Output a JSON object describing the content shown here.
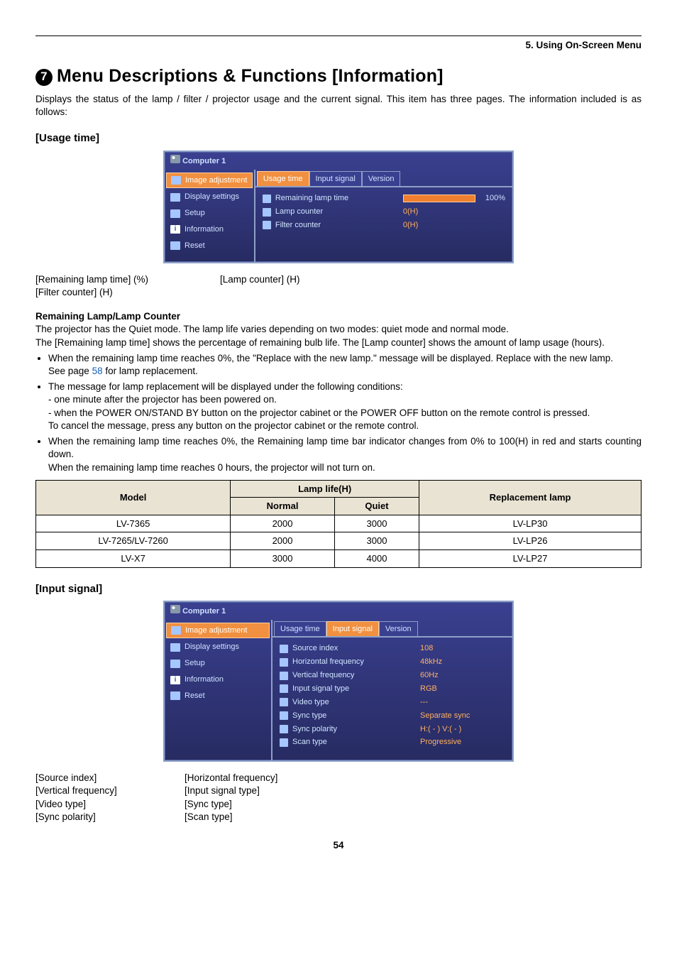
{
  "header": {
    "chapter": "5. Using On-Screen Menu"
  },
  "title": {
    "num": "7",
    "text": "Menu Descriptions & Functions [Information]"
  },
  "intro": "Displays the status of the lamp / filter / projector usage and the current signal. This item has three pages. The information included is as follows:",
  "usage": {
    "heading": "[Usage time]",
    "osd": {
      "title": "Computer 1",
      "sidebar": [
        "Image adjustment",
        "Display settings",
        "Setup",
        "Information",
        "Reset"
      ],
      "tabs": [
        "Usage time",
        "Input signal",
        "Version"
      ],
      "active_tab": 0,
      "rows": [
        {
          "label": "Remaining lamp time",
          "bar": true,
          "pct": "100%"
        },
        {
          "label": "Lamp counter",
          "val": "0(H)"
        },
        {
          "label": "Filter counter",
          "val": "0(H)"
        }
      ]
    },
    "pairs": {
      "a1": "[Remaining lamp time] (%)",
      "a2": "[Lamp counter] (H)",
      "b1": "[Filter counter] (H)"
    },
    "sub_heading": "Remaining Lamp/Lamp Counter",
    "p1": "The projector has the Quiet mode. The lamp life varies depending on two modes: quiet mode and normal mode.",
    "p2": "The [Remaining lamp time] shows the percentage of remaining bulb life. The [Lamp counter] shows the amount of lamp usage (hours).",
    "b1_a": "When the remaining lamp time reaches 0%,  the \"Replace with the new lamp.\" message will be displayed. Replace with the new lamp.",
    "b1_b_pre": "See page ",
    "b1_b_link": "58",
    "b1_b_post": " for lamp replacement.",
    "b2_a": "The message for lamp replacement will be displayed under the following conditions:",
    "b2_b": "- one minute after the projector has been powered on.",
    "b2_c": "- when the POWER ON/STAND BY button on the projector cabinet or the POWER OFF button on the remote control is pressed.",
    "b2_d": "To cancel the message, press any button on the projector cabinet or the remote control.",
    "b3_a": "When the remaining lamp time reaches 0%, the Remaining lamp time bar indicator changes from 0% to 100(H) in red and starts counting down.",
    "b3_b": "When the remaining lamp time reaches 0 hours, the projector will not turn on."
  },
  "table": {
    "h_model": "Model",
    "h_life": "Lamp life(H)",
    "h_normal": "Normal",
    "h_quiet": "Quiet",
    "h_repl": "Replacement lamp",
    "rows": [
      {
        "model": "LV-7365",
        "normal": "2000",
        "quiet": "3000",
        "repl": "LV-LP30"
      },
      {
        "model": "LV-7265/LV-7260",
        "normal": "2000",
        "quiet": "3000",
        "repl": "LV-LP26"
      },
      {
        "model": "LV-X7",
        "normal": "3000",
        "quiet": "4000",
        "repl": "LV-LP27"
      }
    ]
  },
  "input": {
    "heading": "[Input signal]",
    "osd": {
      "title": "Computer 1",
      "sidebar": [
        "Image adjustment",
        "Display settings",
        "Setup",
        "Information",
        "Reset"
      ],
      "tabs": [
        "Usage time",
        "Input signal",
        "Version"
      ],
      "active_tab": 1,
      "rows": [
        {
          "label": "Source index",
          "val": "108"
        },
        {
          "label": "Horizontal frequency",
          "val": "48kHz"
        },
        {
          "label": "Vertical frequency",
          "val": "60Hz"
        },
        {
          "label": "Input signal type",
          "val": "RGB"
        },
        {
          "label": "Video type",
          "val": "---"
        },
        {
          "label": "Sync type",
          "val": "Separate sync"
        },
        {
          "label": "Sync polarity",
          "val": "H:( - ) V:( - )"
        },
        {
          "label": "Scan type",
          "val": "Progressive"
        }
      ]
    },
    "pairs": {
      "a1": "[Source index]",
      "a2": "[Horizontal frequency]",
      "b1": "[Vertical frequency]",
      "b2": "[Input signal type]",
      "c1": "[Video type]",
      "c2": "[Sync type]",
      "d1": "[Sync polarity]",
      "d2": "[Scan type]"
    }
  },
  "page": "54"
}
